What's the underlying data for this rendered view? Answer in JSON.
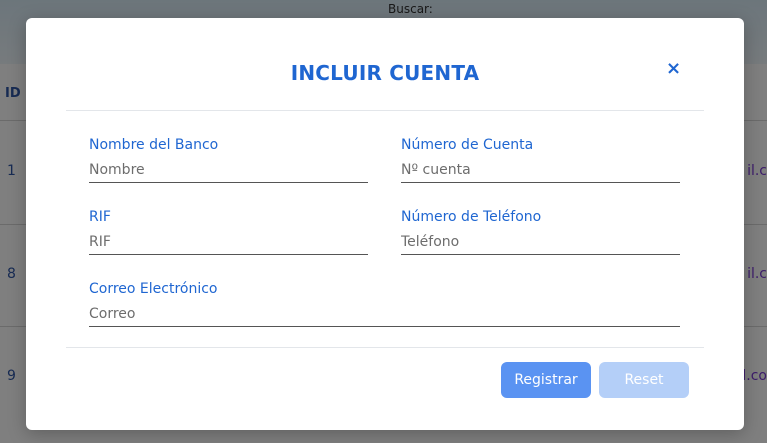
{
  "background": {
    "search_label": "Buscar:",
    "column_id": "ID",
    "rows": [
      {
        "id": "1",
        "email_fragment": "il.c"
      },
      {
        "id": "8",
        "email_fragment": "il.c"
      },
      {
        "id": "9",
        "email_fragment": "l.co"
      }
    ]
  },
  "modal": {
    "title": "INCLUIR CUENTA",
    "close_symbol": "×",
    "fields": {
      "bank_name": {
        "label": "Nombre del Banco",
        "placeholder": "Nombre",
        "value": ""
      },
      "account_number": {
        "label": "Número de Cuenta",
        "placeholder": "Nº cuenta",
        "value": ""
      },
      "rif": {
        "label": "RIF",
        "placeholder": "RIF",
        "value": ""
      },
      "phone": {
        "label": "Número de Teléfono",
        "placeholder": "Teléfono",
        "value": ""
      },
      "email": {
        "label": "Correo Electrónico",
        "placeholder": "Correo",
        "value": ""
      }
    },
    "buttons": {
      "submit_label": "Registrar",
      "reset_label": "Reset"
    }
  },
  "colors": {
    "accent": "#1f66d1",
    "primary_button": "#5a93f2",
    "disabled_button": "#b4cff8",
    "overlay": "#000000"
  },
  "icons": {
    "close": "close-icon"
  }
}
